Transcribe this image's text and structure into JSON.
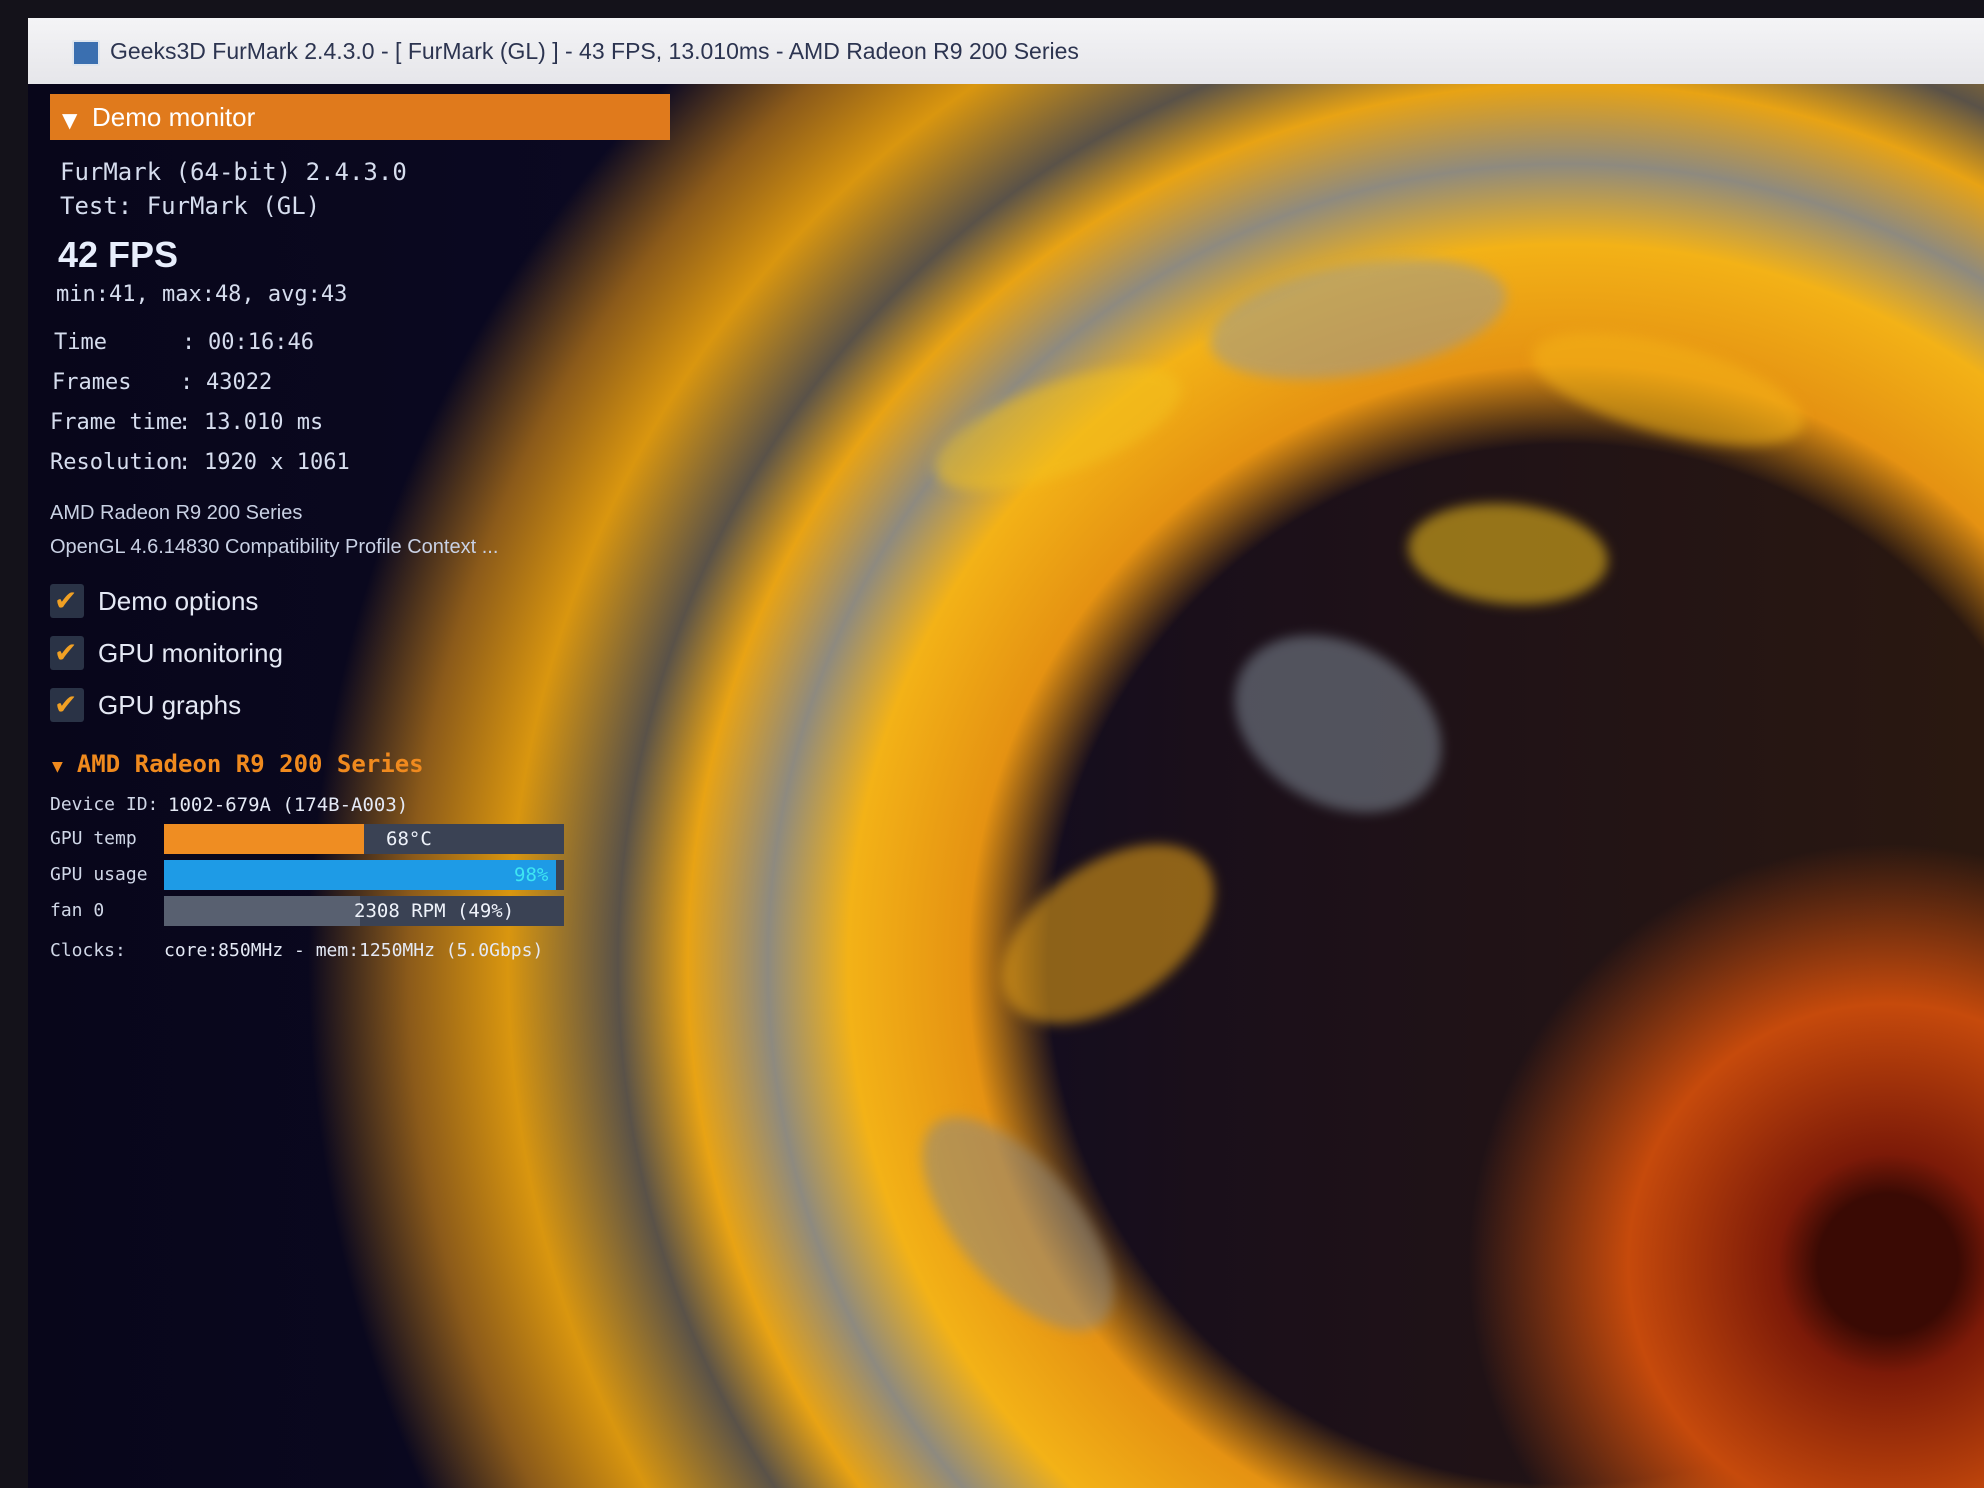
{
  "window": {
    "title": "Geeks3D FurMark 2.4.3.0 - [ FurMark (GL) ] - 43 FPS, 13.010ms - AMD Radeon R9 200 Series"
  },
  "panel": {
    "header": "Demo monitor",
    "app_line": "FurMark (64-bit) 2.4.3.0",
    "test_line": "Test: FurMark (GL)",
    "fps": "42 FPS",
    "fps_stats": "min:41, max:48, avg:43",
    "stats": [
      {
        "key": "Time",
        "value": "00:16:46"
      },
      {
        "key": "Frames",
        "value": "43022"
      },
      {
        "key": "Frame time",
        "value": "13.010 ms"
      },
      {
        "key": "Resolution",
        "value": "1920 x 1061"
      }
    ],
    "stat_sep": ":",
    "gpu_name": "AMD Radeon R9 200 Series",
    "opengl": "OpenGL 4.6.14830 Compatibility Profile Context ...",
    "options": [
      {
        "label": "Demo options",
        "checked": true
      },
      {
        "label": "GPU monitoring",
        "checked": true
      },
      {
        "label": "GPU graphs",
        "checked": true
      }
    ]
  },
  "gpu_section": {
    "title": "AMD Radeon R9 200 Series",
    "device_id_label": "Device ID:",
    "device_id": "1002-679A (174B-A003)",
    "temp_label": "GPU temp",
    "temp_text": "68°C",
    "temp_fraction": 0.5,
    "usage_label": "GPU usage",
    "usage_text": "98%",
    "usage_fraction": 0.98,
    "fan_label": "fan 0",
    "fan_text": "2308 RPM (49%)",
    "fan_fraction": 0.49,
    "clocks_label": "Clocks:",
    "clocks": "core:850MHz - mem:1250MHz (5.0Gbps)"
  },
  "colors": {
    "accent": "#e07a1c",
    "temp_bar": "#ef8d22",
    "usage_bar": "#1e9be6",
    "fan_bar": "#586070"
  }
}
